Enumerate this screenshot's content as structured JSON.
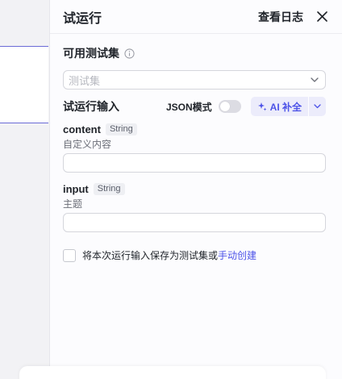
{
  "panel": {
    "title": "试运行",
    "view_logs_label": "查看日志",
    "close_icon": "close-icon"
  },
  "testset": {
    "title": "可用测试集",
    "info_icon": "info-icon",
    "select_placeholder": "测试集",
    "chevron_icon": "chevron-down-icon"
  },
  "trial_input": {
    "heading": "试运行输入",
    "json_mode_label": "JSON模式",
    "json_mode_on": false,
    "ai_fill_label": "AI 补全",
    "ai_icon": "sparkle-icon",
    "accent_color": "#4d53e8"
  },
  "fields": [
    {
      "name": "content",
      "type": "String",
      "description": "自定义内容",
      "value": ""
    },
    {
      "name": "input",
      "type": "String",
      "description": "主题",
      "value": ""
    }
  ],
  "save": {
    "checked": false,
    "text": "将本次运行输入保存为测试集或",
    "link": "手动创建"
  }
}
